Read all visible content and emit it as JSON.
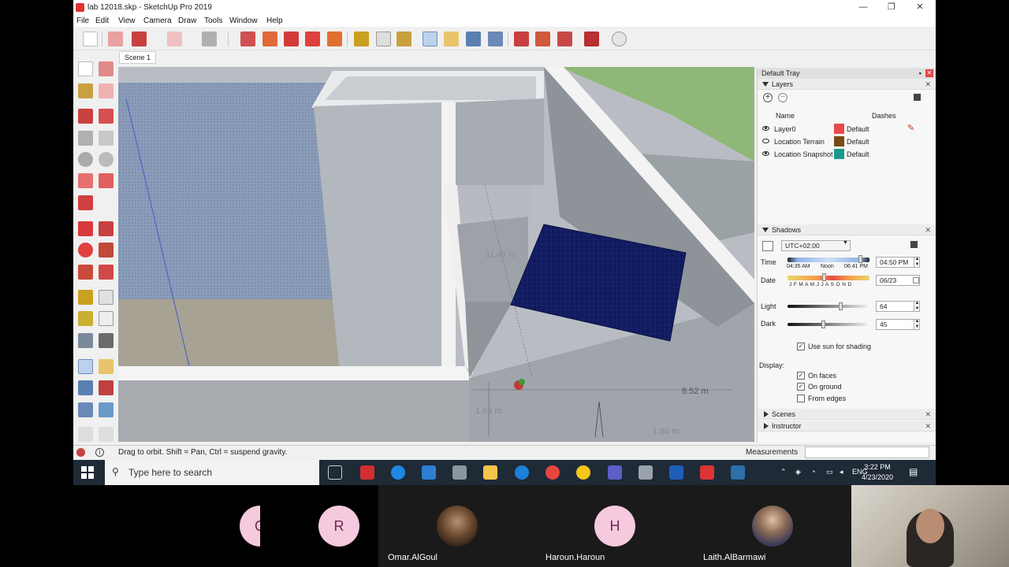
{
  "window": {
    "title": "lab 12018.skp - SketchUp Pro 2019",
    "controls": {
      "minimize": "—",
      "restore": "❐",
      "close": "✕"
    }
  },
  "menu": [
    "File",
    "Edit",
    "View",
    "Camera",
    "Draw",
    "Tools",
    "Window",
    "Help"
  ],
  "scene_tab": "Scene 1",
  "viewport": {
    "dimension_1": "11.47 m",
    "dimension_2": "8.52 m",
    "dimension_3": "1.63 m",
    "dimension_4": "1.80 m"
  },
  "tray": {
    "title": "Default Tray",
    "layers": {
      "label": "Layers",
      "col_name": "Name",
      "col_dashes": "Dashes",
      "rows": [
        {
          "name": "Layer0",
          "color": "#e84a4a",
          "dashes": "Default",
          "visible": true
        },
        {
          "name": "Location Terrain",
          "color": "#7a4a16",
          "dashes": "Default",
          "visible": false
        },
        {
          "name": "Location Snapshot",
          "color": "#1a9a8a",
          "dashes": "Default",
          "visible": true
        }
      ]
    },
    "shadows": {
      "label": "Shadows",
      "timezone": "UTC+02:00",
      "time_label": "Time",
      "time_start": "04:35 AM",
      "time_noon": "Noon",
      "time_end": "06:41 PM",
      "time_value": "04:50 PM",
      "date_label": "Date",
      "months": "J F M A M J J A S O N D",
      "date_value": "06/23",
      "light_label": "Light",
      "light_value": "64",
      "dark_label": "Dark",
      "dark_value": "45",
      "use_sun": "Use sun for shading",
      "display_label": "Display:",
      "on_faces": "On faces",
      "on_ground": "On ground",
      "from_edges": "From edges"
    },
    "scenes_label": "Scenes",
    "instructor_label": "Instructor"
  },
  "status": {
    "message": "Drag to orbit. Shift = Pan, Ctrl = suspend gravity.",
    "measurements_label": "Measurements"
  },
  "taskbar": {
    "search_placeholder": "Type here to search",
    "language": "ENG",
    "time": "3:22 PM",
    "date": "4/23/2020"
  },
  "participants": [
    {
      "initial": "Q",
      "name": ""
    },
    {
      "initial": "R",
      "name": ""
    },
    {
      "initial": "",
      "name": "Omar.AlGoul"
    },
    {
      "initial": "H",
      "name": "Haroun.Haroun"
    },
    {
      "initial": "",
      "name": "Laith.AlBarmawi"
    }
  ]
}
